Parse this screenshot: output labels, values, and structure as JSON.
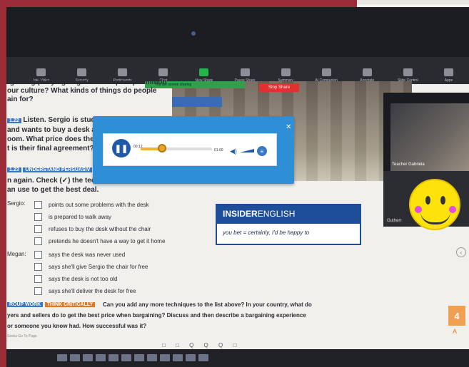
{
  "zoom_toolbar": {
    "items": [
      "Join Video",
      "Security",
      "Participants",
      "Chat",
      "New Share",
      "Pause Share",
      "Summary",
      "AI Companion",
      "Annotate",
      "Slide Control",
      "Apps"
    ],
    "sharing_label": "You are screen sharing",
    "stop_share": "Stop Share"
  },
  "lesson": {
    "line1": "rgaining (= trying to get a lower price) common",
    "line2": "our culture? What kinds of things do people",
    "line3": "ain for?",
    "badge_listen": "1.22",
    "listen_text": "Listen. Sergio is studyin",
    "line5": "and wants to buy a desk at a",
    "line6": "oom. What price does the se",
    "line7": "t is their final agreement?",
    "badge_num": "1.23",
    "badge_understand": "UNDERSTAND PERSUASIV",
    "line9": "n again. Check (✓) the techniques Sergio and",
    "line10": "an use to get the best deal.",
    "sergio_label": "Sergio:",
    "sergio_items": [
      "points out some problems with the desk",
      "is prepared to walk away",
      "refuses to buy the desk without the chair",
      "pretends he doesn't have a way to get it home"
    ],
    "megan_label": "Megan:",
    "megan_items": [
      "says the desk was never used",
      "says she'll give Sergio the chair for free",
      "says the desk is not too old",
      "says she'll deliver the desk for free"
    ],
    "badge_group": "ROUP WORK",
    "badge_think": "THINK CRITICALLY",
    "group_text1": "Can you add any more techniques to the list above? In your country, what do",
    "group_text2": "yers and sellers do to get the best price when bargaining? Discuss and then describe a bargaining experience",
    "group_text3": "or someone you know had. How successful was it?",
    "footer_small": "Seeks      Go To Page"
  },
  "audio_player": {
    "time_elapsed": "00:12",
    "time_total": "01:00",
    "progress_fraction": 0.3
  },
  "insider": {
    "heading_bold": "INSIDER",
    "heading_rest": " ENGLISH",
    "text": "you bet = certainly, I'd be happy to"
  },
  "video": {
    "teacher_label": "Teacher Gabriela",
    "student_label": "Gutherr"
  },
  "page_number": "4",
  "page_sub": "A",
  "pdf_tools": "□ □ Q Q Q □",
  "colors": {
    "frame": "#9b2c37",
    "player": "#2f8fd6",
    "insider": "#1e4e9a",
    "badge_blue": "#3b78c4",
    "badge_orange": "#e07a2a",
    "smiley": "#fde30a"
  }
}
